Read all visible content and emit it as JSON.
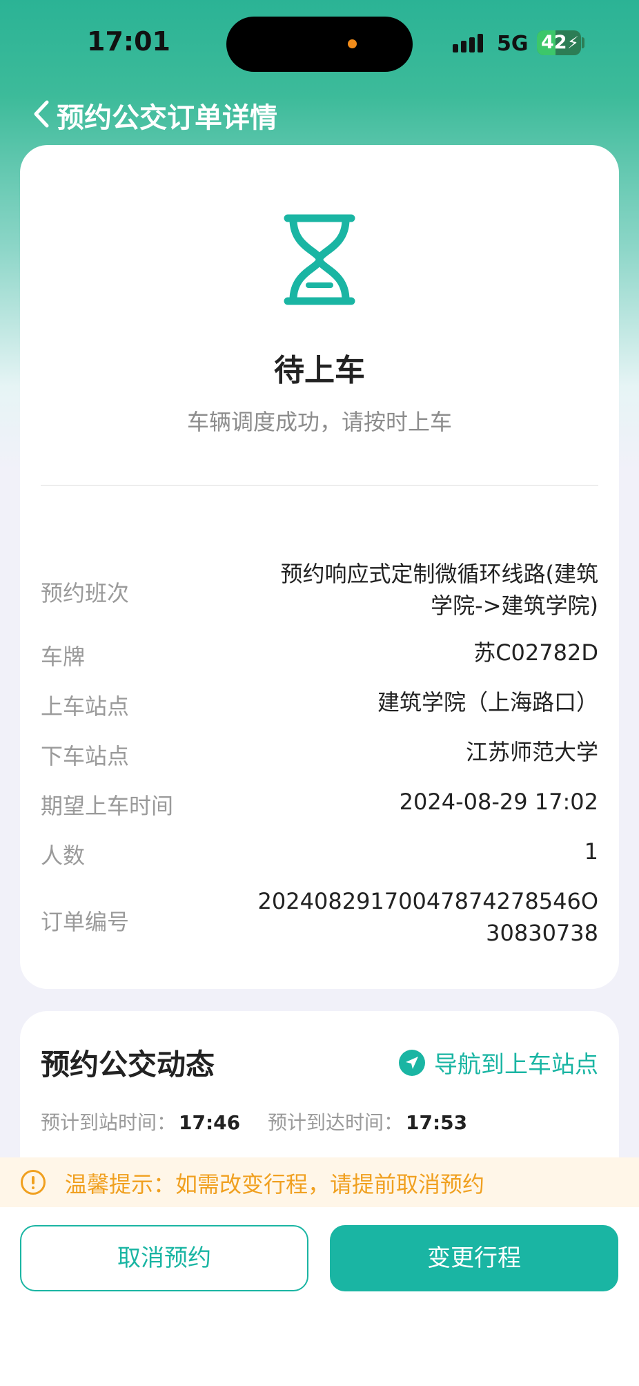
{
  "status_bar": {
    "time": "17:01",
    "network": "5G",
    "battery": "42",
    "battery_level": 0.42
  },
  "nav": {
    "title": "预约公交订单详情"
  },
  "status": {
    "title": "待上车",
    "subtitle": "车辆调度成功，请按时上车"
  },
  "details": [
    {
      "label": "预约班次",
      "value_lines": [
        "预约响应式定制微循环线路(建筑",
        "学院->建筑学院)"
      ]
    },
    {
      "label": "车牌",
      "value_lines": [
        "苏C02782D"
      ]
    },
    {
      "label": "上车站点",
      "value_lines": [
        "建筑学院（上海路口）"
      ]
    },
    {
      "label": "下车站点",
      "value_lines": [
        "江苏师范大学"
      ]
    },
    {
      "label": "期望上车时间",
      "value_lines": [
        "2024-08-29 17:02"
      ]
    },
    {
      "label": "人数",
      "value_lines": [
        "1"
      ]
    },
    {
      "label": "订单编号",
      "value_lines": [
        "20240829170047874278546O",
        "30830738"
      ]
    }
  ],
  "dynamics": {
    "title": "预约公交动态",
    "nav_link": "导航到上车站点",
    "eta_station_label": "预计到站时间：",
    "eta_station_value": "17:46",
    "eta_arrive_label": "预计到达时间：",
    "eta_arrive_value": "17:53"
  },
  "tip": {
    "text": "温馨提示：如需改变行程，请提前取消预约"
  },
  "buttons": {
    "cancel": "取消预约",
    "change": "变更行程"
  },
  "colors": {
    "accent": "#1ab5a3",
    "warning": "#f0a020",
    "header": "#2bb395"
  }
}
